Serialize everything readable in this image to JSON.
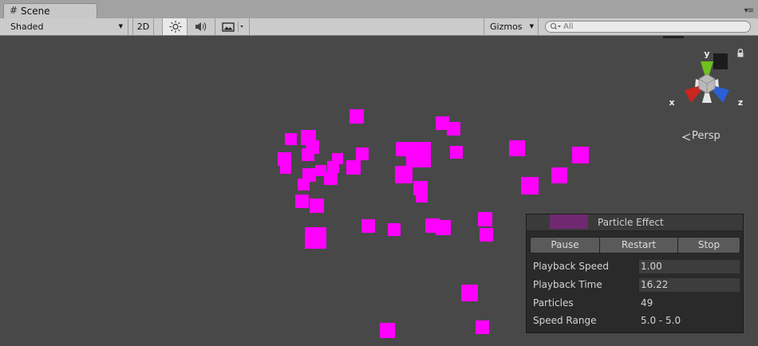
{
  "tab": {
    "icon": "grid-hash-icon",
    "label": "Scene"
  },
  "toolbar": {
    "shading_mode": "Shaded",
    "mode_2d_label": "2D",
    "lighting_icon": "sun-icon",
    "audio_icon": "speaker-icon",
    "effects_icon": "image-icon",
    "gizmos_label": "Gizmos",
    "search_placeholder": "All"
  },
  "viewport": {
    "background_color": "#484848",
    "particle_color": "#ff00ff",
    "projection_label": "Persp",
    "axes": {
      "x_label": "x",
      "y_label": "y",
      "z_label": "z",
      "x_color": "#c8261f",
      "y_color": "#6fc21b",
      "z_color": "#2b5fd4"
    }
  },
  "particle_effect": {
    "title": "Particle Effect",
    "buttons": {
      "pause": "Pause",
      "restart": "Restart",
      "stop": "Stop"
    },
    "rows": [
      {
        "label": "Playback Speed",
        "value": "1.00",
        "editable": true
      },
      {
        "label": "Playback Time",
        "value": "16.22",
        "editable": true
      },
      {
        "label": "Particles",
        "value": "49",
        "editable": false
      },
      {
        "label": "Speed Range",
        "value": "5.0 - 5.0",
        "editable": false
      }
    ]
  }
}
